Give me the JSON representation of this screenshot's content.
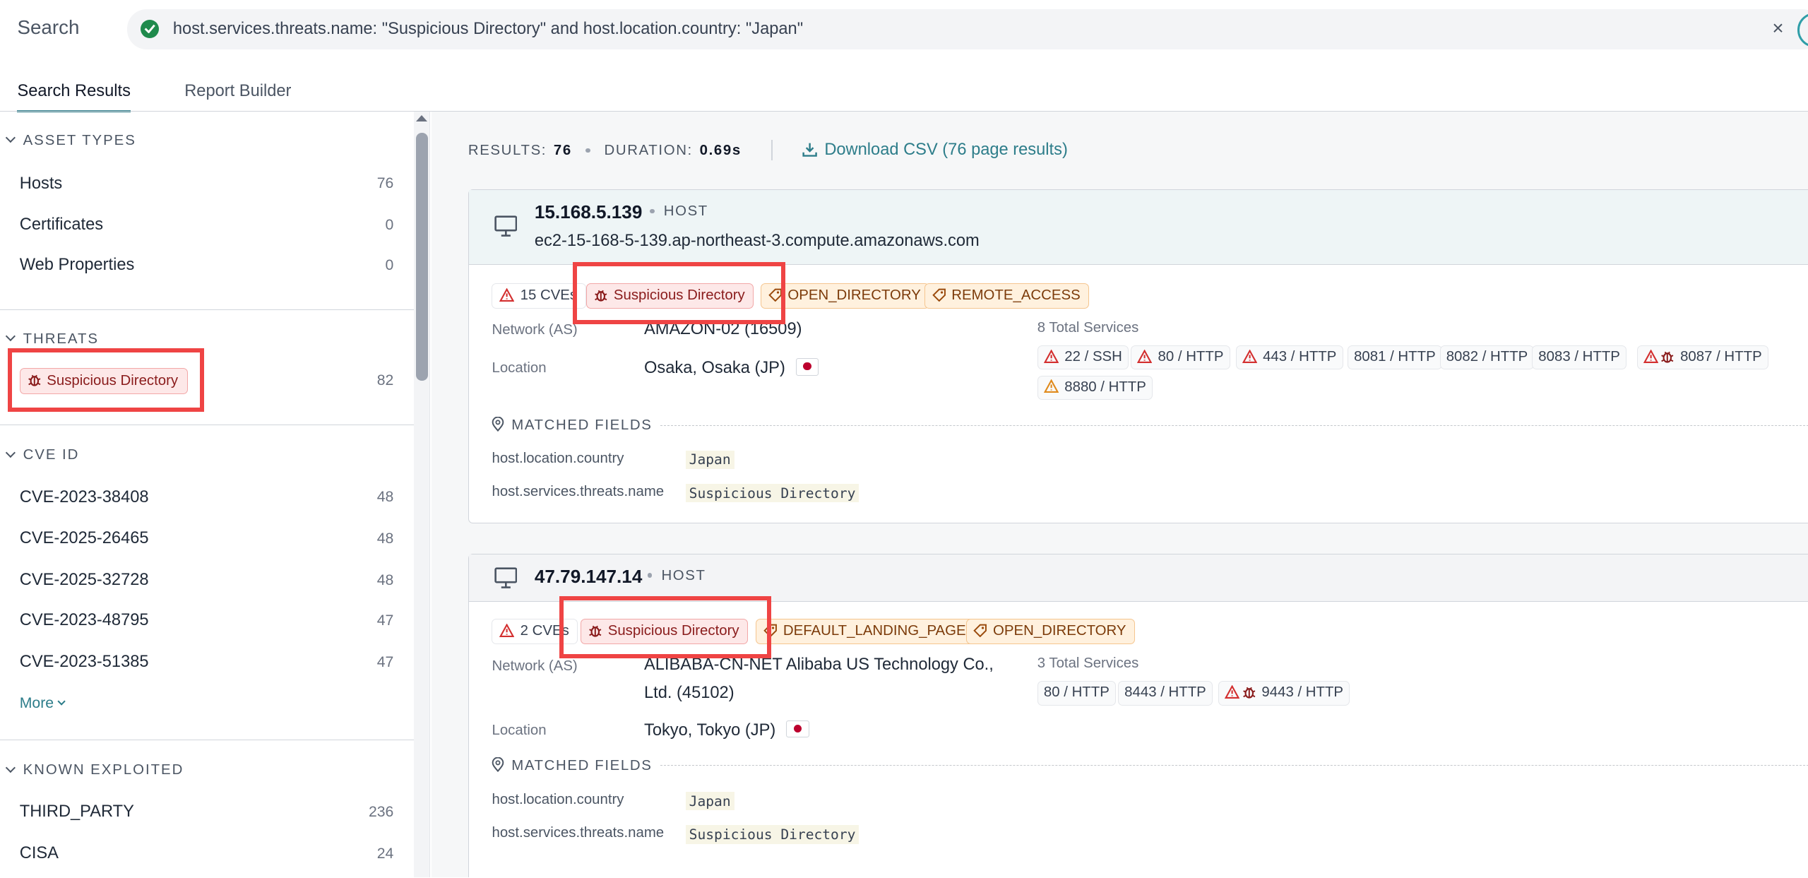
{
  "search": {
    "label": "Search",
    "query": "host.services.threats.name: \"Suspicious Directory\" and host.location.country: \"Japan\"",
    "clear_glyph": "×",
    "valid_icon": "check-circle-icon"
  },
  "tabs": [
    {
      "label": "Search Results",
      "active": true
    },
    {
      "label": "Report Builder",
      "active": false
    }
  ],
  "sidebar": {
    "asset_types": {
      "heading": "ASSET TYPES",
      "items": [
        {
          "label": "Hosts",
          "count": "76"
        },
        {
          "label": "Certificates",
          "count": "0"
        },
        {
          "label": "Web Properties",
          "count": "0"
        }
      ]
    },
    "threats": {
      "heading": "THREATS",
      "items": [
        {
          "label": "Suspicious Directory",
          "count": "82",
          "icon": "bug-icon"
        }
      ]
    },
    "cve_id": {
      "heading": "CVE ID",
      "items": [
        {
          "label": "CVE-2023-38408",
          "count": "48"
        },
        {
          "label": "CVE-2025-26465",
          "count": "48"
        },
        {
          "label": "CVE-2025-32728",
          "count": "48"
        },
        {
          "label": "CVE-2023-48795",
          "count": "47"
        },
        {
          "label": "CVE-2023-51385",
          "count": "47"
        }
      ],
      "more_label": "More"
    },
    "known_exploited": {
      "heading": "KNOWN EXPLOITED",
      "items": [
        {
          "label": "THIRD_PARTY",
          "count": "236"
        },
        {
          "label": "CISA",
          "count": "24"
        }
      ]
    }
  },
  "results_meta": {
    "results_label": "RESULTS:",
    "results_value": "76",
    "duration_label": "DURATION:",
    "duration_value": "0.69s",
    "download_label": "Download CSV (76 page results)"
  },
  "hosts": [
    {
      "ip": "15.168.5.139",
      "kind": "HOST",
      "hostname": "ec2-15-168-5-139.ap-northeast-3.compute.amazonaws.com",
      "cve_chip": "15 CVEs",
      "threat_chip": "Suspicious Directory",
      "tags": [
        "OPEN_DIRECTORY",
        "REMOTE_ACCESS"
      ],
      "network_label": "Network (AS)",
      "network": "AMAZON-02 (16509)",
      "location_label": "Location",
      "location": "Osaka, Osaka (JP)",
      "services_title": "8 Total Services",
      "services": [
        "22 / SSH",
        "80 / HTTP",
        "443 / HTTP",
        "8081 / HTTP",
        "8082 / HTTP",
        "8083 / HTTP",
        "8087 / HTTP",
        "8880 / HTTP"
      ],
      "matched_heading": "MATCHED FIELDS",
      "matched_fields": [
        {
          "field": "host.location.country",
          "value": "Japan"
        },
        {
          "field": "host.services.threats.name",
          "value": "Suspicious Directory"
        }
      ]
    },
    {
      "ip": "47.79.147.14",
      "kind": "HOST",
      "cve_chip": "2 CVEs",
      "threat_chip": "Suspicious Directory",
      "tags": [
        "DEFAULT_LANDING_PAGE",
        "OPEN_DIRECTORY"
      ],
      "network_label": "Network (AS)",
      "network_line1": "ALIBABA-CN-NET Alibaba US Technology Co.,",
      "network_line2": "Ltd. (45102)",
      "location_label": "Location",
      "location": "Tokyo, Tokyo (JP)",
      "services_title": "3 Total Services",
      "services": [
        "80 / HTTP",
        "8443 / HTTP",
        "9443 / HTTP"
      ],
      "matched_heading": "MATCHED FIELDS",
      "matched_fields": [
        {
          "field": "host.location.country",
          "value": "Japan"
        },
        {
          "field": "host.services.threats.name",
          "value": "Suspicious Directory"
        }
      ]
    }
  ],
  "colors": {
    "accent": "#2d7d8a",
    "threat_bg": "#fde8e8",
    "tag_bg": "#fff1de",
    "highlight_box": "#ef4444"
  }
}
